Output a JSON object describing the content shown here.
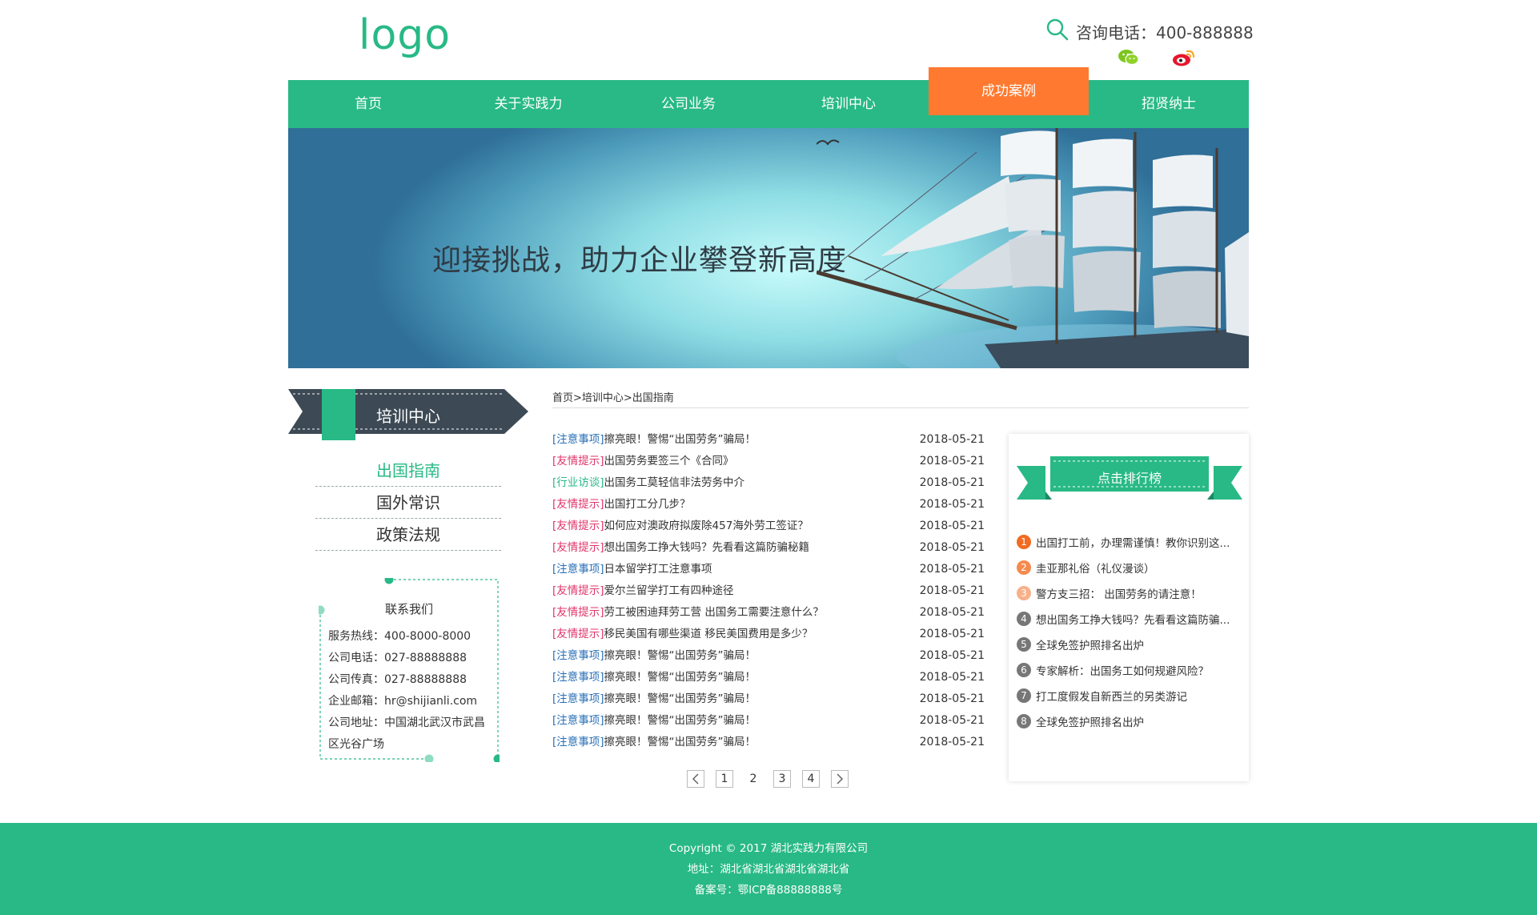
{
  "header": {
    "logo": "logo",
    "phone_label": "咨询电话：400-888888"
  },
  "nav": {
    "items": [
      {
        "label": "首页"
      },
      {
        "label": "关于实践力"
      },
      {
        "label": "公司业务"
      },
      {
        "label": "培训中心"
      },
      {
        "label": "成功案例",
        "active": true
      },
      {
        "label": "招贤纳士"
      }
    ]
  },
  "banner": {
    "slogan": "迎接挑战，助力企业攀登新高度"
  },
  "sidebar": {
    "title": "培训中心",
    "menu": [
      {
        "label": "出国指南",
        "active": true
      },
      {
        "label": "国外常识"
      },
      {
        "label": "政策法规"
      }
    ],
    "contact": {
      "title": "联系我们",
      "lines": [
        "服务热线：400-8000-8000",
        "公司电话：027-88888888",
        "公司传真：027-88888888",
        "企业邮箱：hr@shijianli.com",
        "公司地址：中国湖北武汉市武昌",
        "区光谷广场"
      ]
    }
  },
  "breadcrumb": "首页>培训中心>出国指南",
  "articles": [
    {
      "tag": "[注意事项]",
      "tag_color": "blue",
      "title": "擦亮眼！警惕“出国劳务”骗局！",
      "date": "2018-05-21"
    },
    {
      "tag": "[友情提示]",
      "tag_color": "pink",
      "title": "出国劳务要签三个《合同》",
      "date": "2018-05-21"
    },
    {
      "tag": "[行业访谈]",
      "tag_color": "green",
      "title": "出国务工莫轻信非法劳务中介",
      "date": "2018-05-21"
    },
    {
      "tag": "[友情提示]",
      "tag_color": "pink",
      "title": "出国打工分几步？",
      "date": "2018-05-21"
    },
    {
      "tag": "[友情提示]",
      "tag_color": "pink",
      "title": "如何应对澳政府拟废除457海外劳工签证？",
      "date": "2018-05-21"
    },
    {
      "tag": "[友情提示]",
      "tag_color": "pink",
      "title": "想出国务工挣大钱吗？先看看这篇防骗秘籍",
      "date": "2018-05-21"
    },
    {
      "tag": "[注意事项]",
      "tag_color": "blue",
      "title": "日本留学打工注意事项",
      "date": "2018-05-21"
    },
    {
      "tag": "[友情提示]",
      "tag_color": "pink",
      "title": "爱尔兰留学打工有四种途径",
      "date": "2018-05-21"
    },
    {
      "tag": "[友情提示]",
      "tag_color": "pink",
      "title": "劳工被困迪拜劳工营 出国务工需要注意什么？",
      "date": "2018-05-21"
    },
    {
      "tag": "[友情提示]",
      "tag_color": "pink",
      "title": "移民美国有哪些渠道 移民美国费用是多少？",
      "date": "2018-05-21"
    },
    {
      "tag": "[注意事项]",
      "tag_color": "blue",
      "title": "擦亮眼！警惕“出国劳务”骗局！",
      "date": "2018-05-21"
    },
    {
      "tag": "[注意事项]",
      "tag_color": "blue",
      "title": "擦亮眼！警惕“出国劳务”骗局！",
      "date": "2018-05-21"
    },
    {
      "tag": "[注意事项]",
      "tag_color": "blue",
      "title": "擦亮眼！警惕“出国劳务”骗局！",
      "date": "2018-05-21"
    },
    {
      "tag": "[注意事项]",
      "tag_color": "blue",
      "title": "擦亮眼！警惕“出国劳务”骗局！",
      "date": "2018-05-21"
    },
    {
      "tag": "[注意事项]",
      "tag_color": "blue",
      "title": "擦亮眼！警惕“出国劳务”骗局！",
      "date": "2018-05-21"
    }
  ],
  "pagination": {
    "pages": [
      "1",
      "2",
      "3",
      "4"
    ],
    "current": "2"
  },
  "ranking": {
    "title": "点击排行榜",
    "items": [
      {
        "num": "1",
        "color": "#f26b21",
        "text": "出国打工前，办理需谨慎！教你识别这..."
      },
      {
        "num": "2",
        "color": "#f58a4e",
        "text": "圭亚那礼俗（礼仪漫谈）"
      },
      {
        "num": "3",
        "color": "#f8b089",
        "text": "警方支三招： 出国劳务的请注意！"
      },
      {
        "num": "4",
        "color": "#777777",
        "text": "想出国务工挣大钱吗？先看看这篇防骗..."
      },
      {
        "num": "5",
        "color": "#777777",
        "text": "全球免签护照排名出炉"
      },
      {
        "num": "6",
        "color": "#777777",
        "text": "专家解析：出国务工如何规避风险？"
      },
      {
        "num": "7",
        "color": "#777777",
        "text": "打工度假发自新西兰的另类游记"
      },
      {
        "num": "8",
        "color": "#777777",
        "text": "全球免签护照排名出炉"
      }
    ]
  },
  "footer": {
    "copyright": "Copyright © 2017 湖北实践力有限公司",
    "address": "地址：湖北省湖北省湖北省湖北省",
    "icp": "备案号：鄂ICP备88888888号"
  },
  "colors": {
    "brand": "#28b986",
    "accent": "#ff7a30",
    "dark_ribbon": "#3d4a55"
  },
  "icons": [
    "search-icon",
    "wechat-icon",
    "weibo-icon",
    "chevron-left-icon",
    "chevron-right-icon"
  ]
}
